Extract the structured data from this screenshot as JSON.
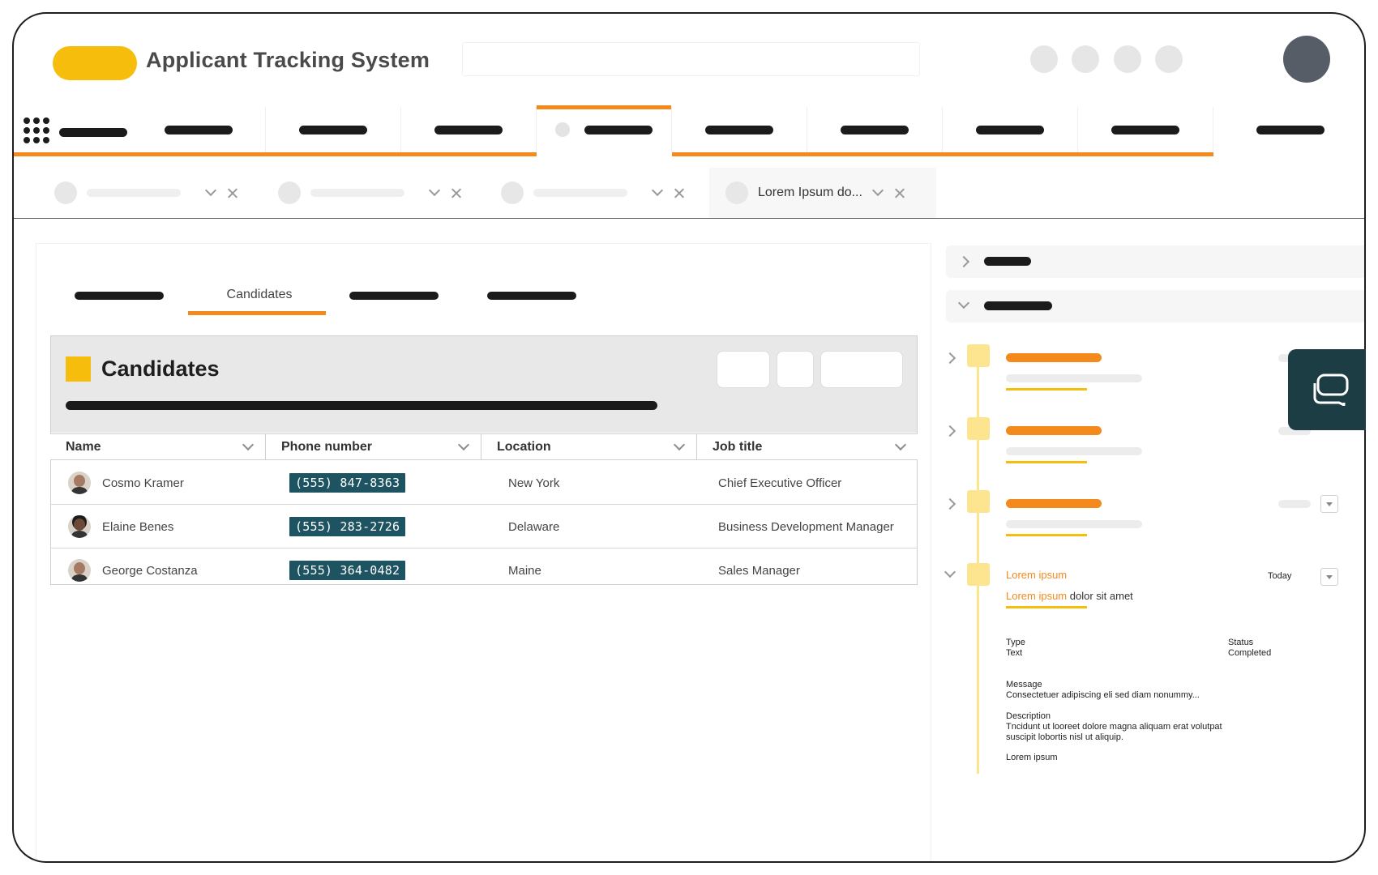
{
  "app": {
    "title": "Applicant Tracking System"
  },
  "header": {
    "search_placeholder": ""
  },
  "subtabs": [
    {
      "label": ""
    },
    {
      "label": ""
    },
    {
      "label": ""
    },
    {
      "label": "Lorem Ipsum do..."
    }
  ],
  "panel_tabs": {
    "active_label": "Candidates"
  },
  "candidates": {
    "title": "Candidates",
    "columns": [
      "Name",
      "Phone number",
      "Location",
      "Job title"
    ],
    "rows": [
      {
        "name": "Cosmo Kramer",
        "phone": "(555) 847-8363",
        "location": "New York",
        "job": "Chief Executive Officer"
      },
      {
        "name": "Elaine Benes",
        "phone": "(555) 283-2726",
        "location": "Delaware",
        "job": "Business Development Manager"
      },
      {
        "name": "George Costanza",
        "phone": "(555) 364-0482",
        "location": "Maine",
        "job": "Sales Manager"
      }
    ]
  },
  "activity": {
    "entry": {
      "title": "Lorem ipsum",
      "date": "Today",
      "subtitle_highlight": "Lorem ipsum",
      "subtitle_rest": "dolor sit amet",
      "type_label": "Type",
      "type_value": "Text",
      "status_label": "Status",
      "status_value": "Completed",
      "message_label": "Message",
      "message_value": "Consectetuer adipiscing eli sed diam nonummy...",
      "description_label": "Description",
      "description_line1": "Tncidunt ut looreet dolore magna aliquam erat volutpat",
      "description_line2": "suscipit lobortis nisl ut aliquip.",
      "footer": "Lorem ipsum"
    }
  },
  "icons": {
    "menu": "grid-dots-icon",
    "chat": "chat-bubbles-icon",
    "chevron": "chevron-down-icon",
    "close": "close-icon"
  },
  "colors": {
    "accent_orange": "#f48a1c",
    "brand_yellow": "#f7bd0c",
    "phone_chip": "#1e5461",
    "avatar": "#565d67",
    "chat_fab": "#1c3d44"
  }
}
